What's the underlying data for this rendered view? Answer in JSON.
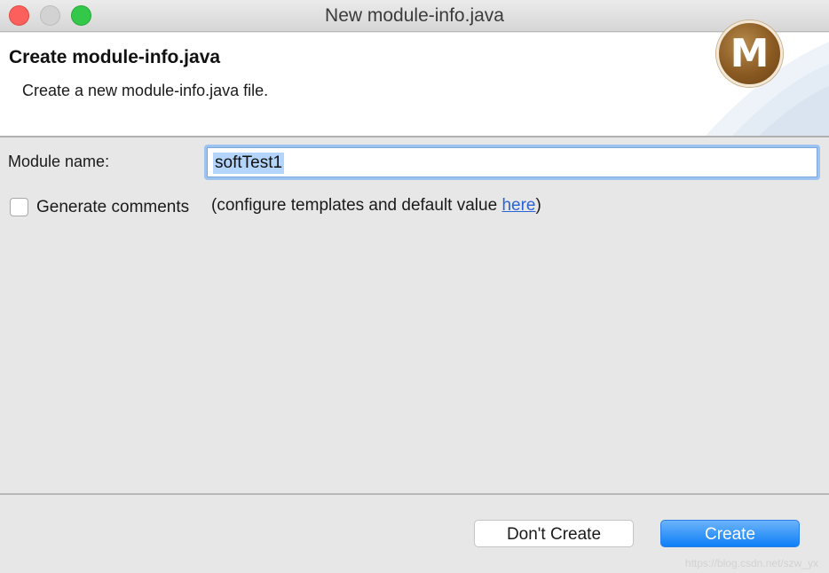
{
  "window": {
    "title": "New module-info.java"
  },
  "banner": {
    "title": "Create module-info.java",
    "description": "Create a new module-info.java file.",
    "logo_letter": "M",
    "logo_icon": "module-logo-icon"
  },
  "form": {
    "module_name_label": "Module name:",
    "module_name_value": "softTest1",
    "generate_comments_label": "Generate comments",
    "generate_comments_checked": false,
    "configure_prefix": "(configure templates and default value ",
    "configure_link": "here",
    "configure_suffix": ")"
  },
  "buttons": {
    "dont_create": "Don't Create",
    "create": "Create"
  },
  "watermark": "https://blog.csdn.net/szw_yx",
  "colors": {
    "accent": "#0d7ff7",
    "link": "#2a63d4",
    "close": "#fc605c",
    "maximize": "#34c84a"
  }
}
